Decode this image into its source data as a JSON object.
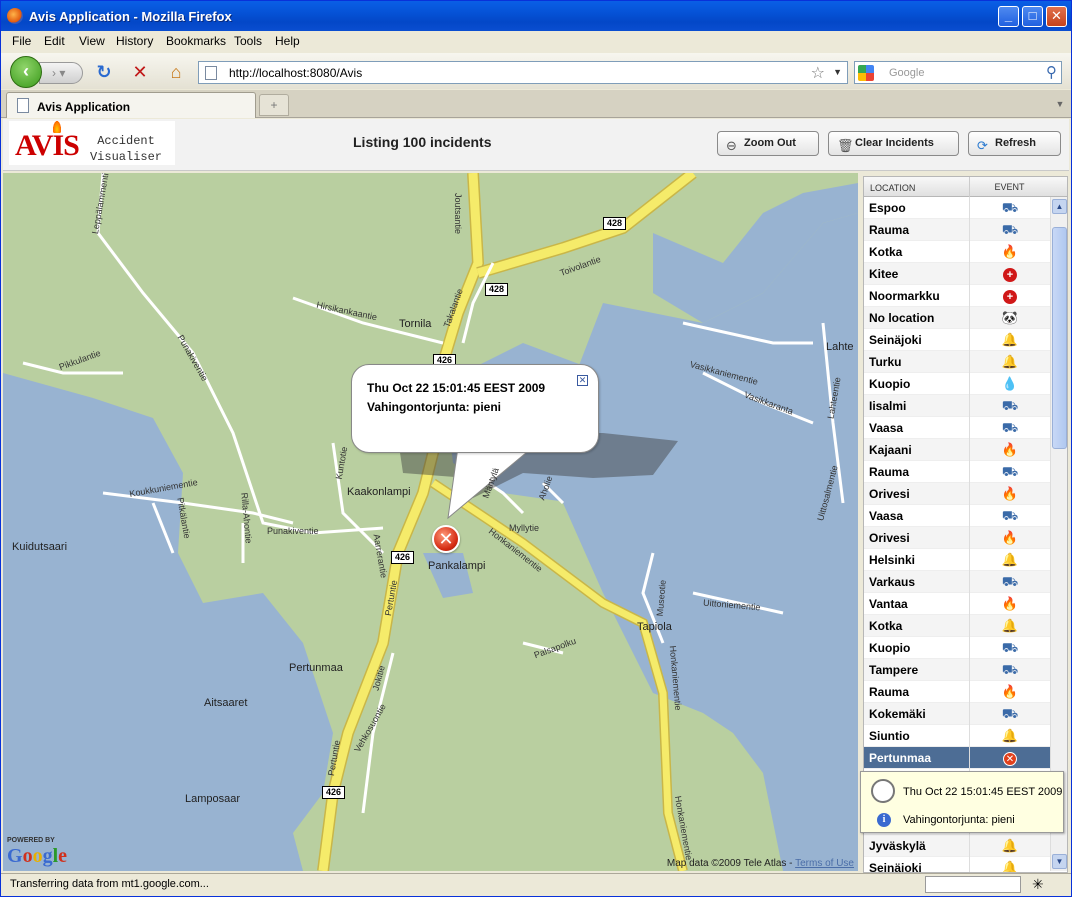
{
  "window": {
    "title": "Avis Application - Mozilla Firefox"
  },
  "menu": [
    "File",
    "Edit",
    "View",
    "History",
    "Bookmarks",
    "Tools",
    "Help"
  ],
  "nav": {
    "url": "http://localhost:8080/Avis",
    "search_placeholder": "Google"
  },
  "tab": {
    "title": "Avis Application"
  },
  "app": {
    "logo_text": "AVIS",
    "logo_sub": "Accident\nVisualiser",
    "listing": "Listing 100 incidents",
    "buttons": {
      "zoom_out": "Zoom Out",
      "clear": "Clear Incidents",
      "refresh": "Refresh"
    }
  },
  "map": {
    "balloon": {
      "date": "Thu Oct 22 15:01:45 EEST 2009",
      "desc": "Vahingontorjunta: pieni"
    },
    "places": {
      "tornila": "Tornila",
      "lahte": "Lahte",
      "kaakonlampi": "Kaakonlampi",
      "pankalampi": "Pankalampi",
      "kuidutsaari": "Kuidutsaari",
      "tapiola": "Tapiola",
      "pertunmaa": "Pertunmaa",
      "aitsaaret": "Aitsaaret",
      "lamposaar": "Lamposaar"
    },
    "roads": {
      "joutsantie": "Joutsantie",
      "toivolantie": "Toivolantie",
      "hirsikankaantie": "Hirsikankaantie",
      "takalantie": "Takalantie",
      "pikkulantie": "Pikkulantie",
      "punakiventie_a": "Punakiventie",
      "punakiventie_b": "Punakiventie",
      "leppalammentie": "Leppälammentie",
      "kuntotie": "Kuntotie",
      "koukkuniementie": "Koukkuniementie",
      "pitkalantie": "Pitkälantie",
      "rilla": "Rilla-Ahontie",
      "aarrerantie": "Aarrerantie",
      "manty": "Mäntylä",
      "aholie": "Aholie",
      "myllytie": "Myllytie",
      "honkaniementie": "Honkaniementie",
      "honkaniementie2": "Honkaniementie",
      "honkaniementie3": "Honkaniementie",
      "uittoniementie": "Uittoniementie",
      "vasikkaniementie": "Vasikkaniementie",
      "vasikkaranta": "Vasikkaranta",
      "uittosalmentie": "Uittosalmentie",
      "lahteentie": "Lahteentie",
      "pertuntie": "Pertuntie",
      "pertuntie2": "Pertuntie",
      "jokitie": "Jokitie",
      "vehkosuontie": "Vehkosuontie",
      "museotie": "Museotie",
      "palsapolku": "Palsapolku"
    },
    "shields": {
      "s428a": "428",
      "s428b": "428",
      "s426a": "426",
      "s426b": "426",
      "s426c": "426"
    },
    "powered_by": "POWERED BY",
    "google": "Google",
    "map_data": "Map data ©2009 Tele Atlas - ",
    "terms": "Terms of Use"
  },
  "list": {
    "headers": {
      "location": "LOCATION",
      "event": "EVENT"
    },
    "rows": [
      {
        "loc": "Espoo",
        "ev": "truck"
      },
      {
        "loc": "Rauma",
        "ev": "truck"
      },
      {
        "loc": "Kotka",
        "ev": "fire"
      },
      {
        "loc": "Kitee",
        "ev": "cross"
      },
      {
        "loc": "Noormarkku",
        "ev": "cross"
      },
      {
        "loc": "No location",
        "ev": "panda"
      },
      {
        "loc": "Seinäjoki",
        "ev": "bell"
      },
      {
        "loc": "Turku",
        "ev": "bell"
      },
      {
        "loc": "Kuopio",
        "ev": "drop"
      },
      {
        "loc": "Iisalmi",
        "ev": "truck"
      },
      {
        "loc": "Vaasa",
        "ev": "truck"
      },
      {
        "loc": "Kajaani",
        "ev": "fire"
      },
      {
        "loc": "Rauma",
        "ev": "truck"
      },
      {
        "loc": "Orivesi",
        "ev": "fire"
      },
      {
        "loc": "Vaasa",
        "ev": "truck"
      },
      {
        "loc": "Orivesi",
        "ev": "fire"
      },
      {
        "loc": "Helsinki",
        "ev": "bell"
      },
      {
        "loc": "Varkaus",
        "ev": "truck"
      },
      {
        "loc": "Vantaa",
        "ev": "fire"
      },
      {
        "loc": "Kotka",
        "ev": "bell"
      },
      {
        "loc": "Kuopio",
        "ev": "truck"
      },
      {
        "loc": "Tampere",
        "ev": "truck"
      },
      {
        "loc": "Rauma",
        "ev": "fire"
      },
      {
        "loc": "Kokemäki",
        "ev": "truck"
      },
      {
        "loc": "Siuntio",
        "ev": "bell"
      },
      {
        "loc": "Pertunmaa",
        "ev": "xred"
      },
      {
        "loc": "",
        "ev": ""
      },
      {
        "loc": "",
        "ev": ""
      },
      {
        "loc": "",
        "ev": ""
      },
      {
        "loc": "Jyväskylä",
        "ev": "bell"
      },
      {
        "loc": "Seinäjoki",
        "ev": "bell"
      }
    ],
    "selected_index": 25
  },
  "tooltip": {
    "date": "Thu Oct 22 15:01:45 EEST 2009",
    "desc": "Vahingontorjunta: pieni"
  },
  "status": {
    "text": "Transferring data from mt1.google.com..."
  },
  "colors": {
    "water": "#98b3d1",
    "land": "#b9cfa0",
    "road": "#f5eb6a",
    "selected_row": "#4d6d95"
  }
}
